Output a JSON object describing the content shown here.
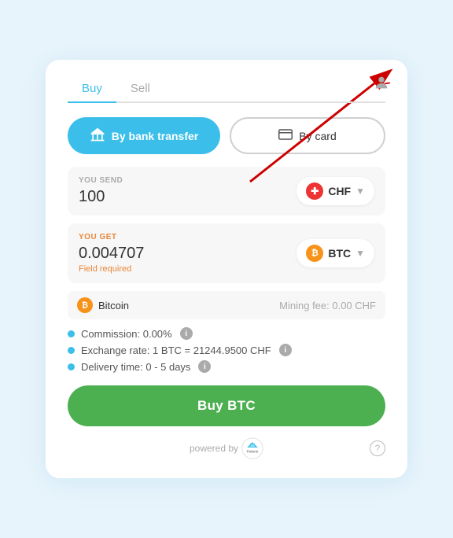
{
  "tabs": [
    {
      "label": "Buy",
      "active": true
    },
    {
      "label": "Sell",
      "active": false
    }
  ],
  "payment": {
    "bank_label": "By bank transfer",
    "card_label": "By card"
  },
  "send": {
    "label": "YOU SEND",
    "value": "100",
    "currency": "CHF",
    "chevron": "▼"
  },
  "get": {
    "label": "YOU GET",
    "value": "0.004707",
    "field_required": "Field required",
    "currency": "BTC",
    "chevron": "▼"
  },
  "coin_row": {
    "coin_name": "Bitcoin",
    "mining_fee": "Mining fee: 0.00 CHF"
  },
  "details": [
    {
      "text": "Commission: 0.00%",
      "has_info": true
    },
    {
      "text": "Exchange rate: 1 BTC = 21244.9500 CHF",
      "has_info": true
    },
    {
      "text": "Delivery time: 0 - 5 days",
      "has_info": true
    }
  ],
  "buy_button": "Buy BTC",
  "footer": {
    "powered_by": "powered by",
    "brand": "Mt\nPelerin"
  }
}
